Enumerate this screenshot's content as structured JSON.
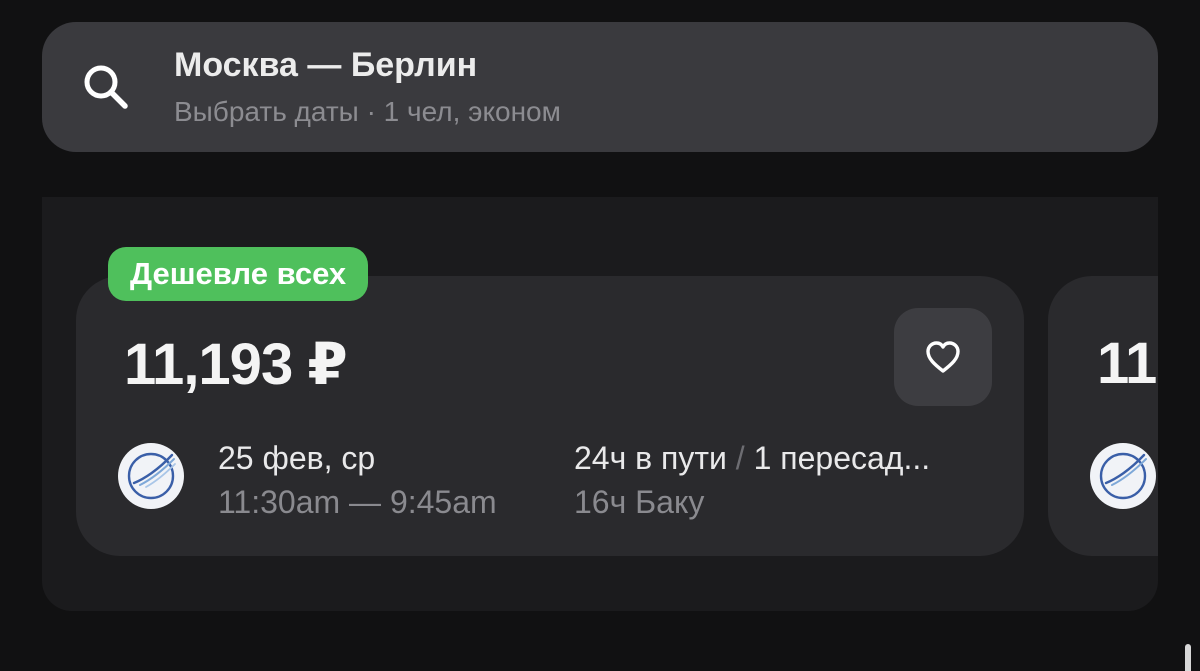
{
  "search": {
    "route": "Москва — Берлин",
    "details": "Выбрать даты · 1 чел, эконом"
  },
  "badge": {
    "label": "Дешевле всех",
    "color": "#4fc05c"
  },
  "tickets": [
    {
      "price": "11,193 ₽",
      "date": "25 фев, ср",
      "time_range": "11:30am — 9:45am",
      "duration": "24ч в пути",
      "separator": "/",
      "stops": "1 пересад...",
      "layover": "16ч Баку",
      "airline_icon": "airline-logo-icon",
      "favorite_icon": "heart-icon"
    },
    {
      "price": "11"
    }
  ],
  "icons": {
    "search": "search-icon",
    "favorite": "heart-icon"
  }
}
